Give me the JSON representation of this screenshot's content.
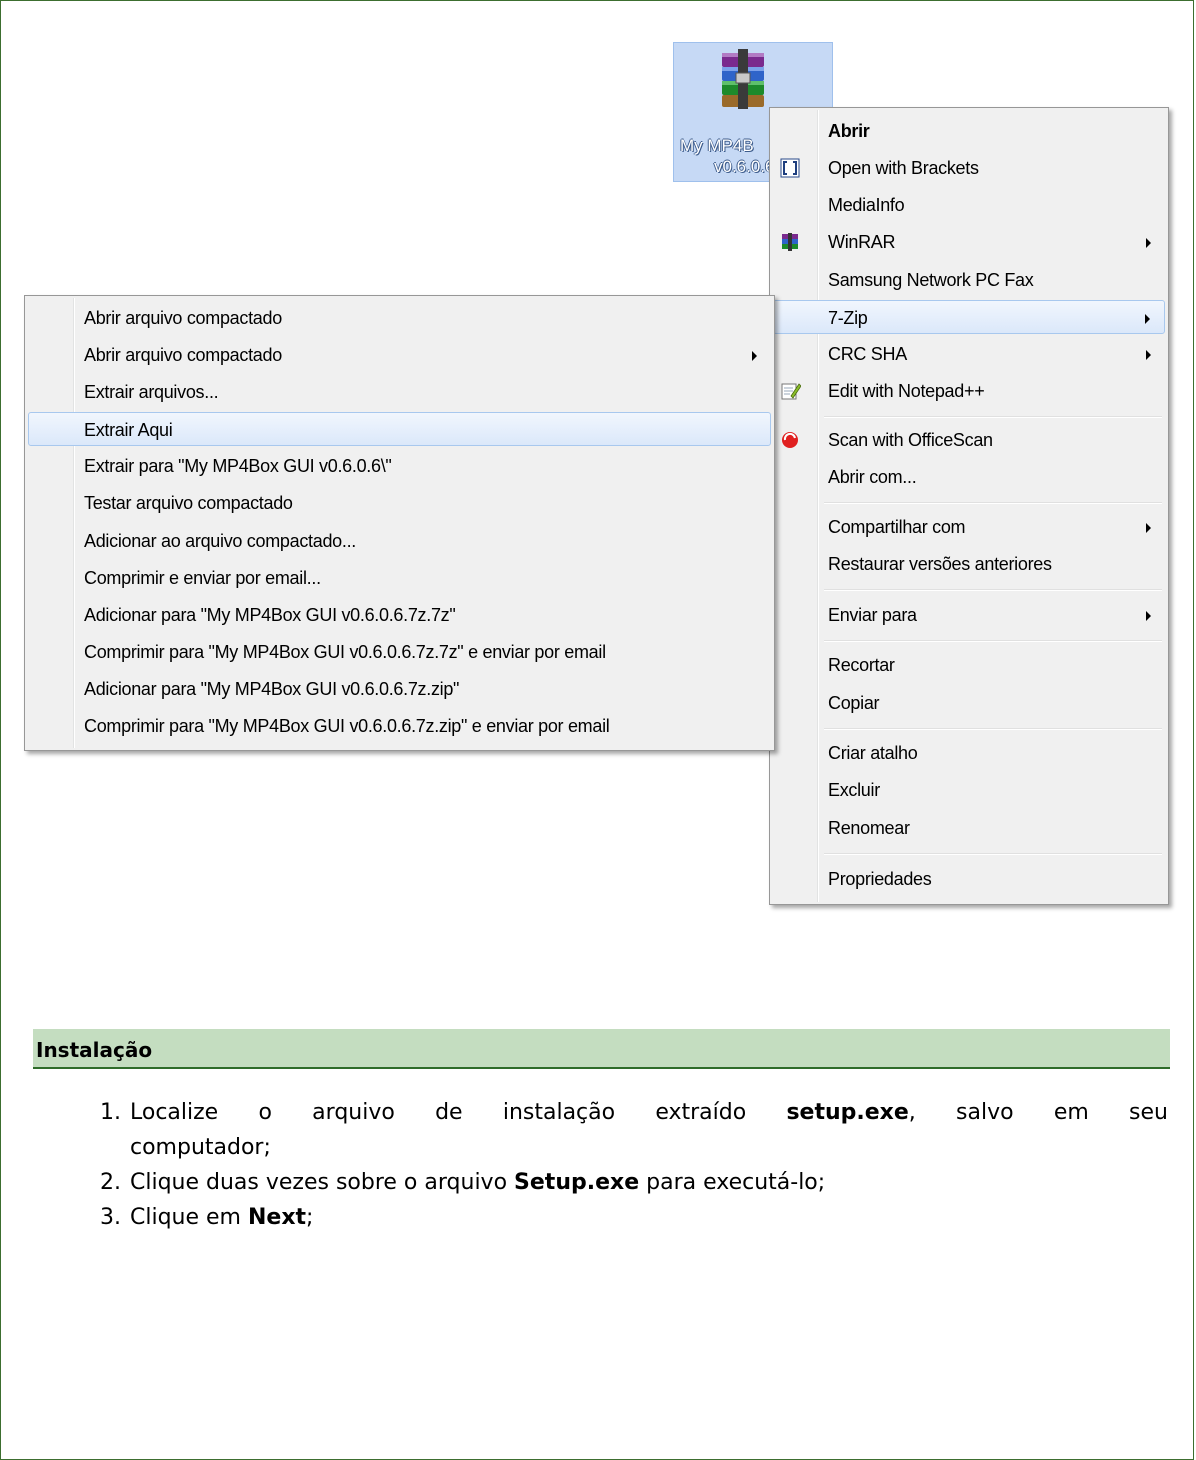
{
  "desktop_icon": {
    "label_line1": "My MP4B",
    "label_line2": "v0.6.0.6",
    "icon": "winrar-archive-icon"
  },
  "context_menu": {
    "items": [
      {
        "label": "Abrir",
        "bold": true
      },
      {
        "label": "Open with Brackets",
        "icon": "brackets-icon"
      },
      {
        "label": "MediaInfo"
      },
      {
        "label": "WinRAR",
        "icon": "winrar-icon",
        "submenu": true
      },
      {
        "label": "Samsung Network PC Fax"
      },
      {
        "label": "7-Zip",
        "submenu": true,
        "highlighted": true
      },
      {
        "label": "CRC SHA",
        "submenu": true
      },
      {
        "label": "Edit with Notepad++",
        "icon": "notepadpp-icon"
      },
      {
        "label": "Scan with OfficeScan",
        "icon": "officescan-icon"
      },
      {
        "label": "Abrir com..."
      },
      {
        "label": "Compartilhar com",
        "submenu": true
      },
      {
        "label": "Restaurar versões anteriores"
      },
      {
        "label": "Enviar para",
        "submenu": true
      },
      {
        "label": "Recortar"
      },
      {
        "label": "Copiar"
      },
      {
        "label": "Criar atalho"
      },
      {
        "label": "Excluir"
      },
      {
        "label": "Renomear"
      },
      {
        "label": "Propriedades"
      }
    ]
  },
  "zip_submenu": {
    "items": [
      {
        "label": "Abrir arquivo compactado"
      },
      {
        "label": "Abrir arquivo compactado",
        "submenu": true
      },
      {
        "label": "Extrair arquivos..."
      },
      {
        "label": "Extrair Aqui",
        "highlighted": true
      },
      {
        "label": "Extrair para \"My MP4Box GUI v0.6.0.6\\\""
      },
      {
        "label": "Testar arquivo compactado"
      },
      {
        "label": "Adicionar ao arquivo compactado..."
      },
      {
        "label": "Comprimir e enviar por email..."
      },
      {
        "label": "Adicionar para \"My MP4Box GUI v0.6.0.6.7z.7z\""
      },
      {
        "label": "Comprimir para \"My MP4Box GUI v0.6.0.6.7z.7z\" e enviar por email"
      },
      {
        "label": "Adicionar para \"My MP4Box GUI v0.6.0.6.7z.zip\""
      },
      {
        "label": "Comprimir para \"My MP4Box GUI v0.6.0.6.7z.zip\" e enviar por email"
      }
    ]
  },
  "section": {
    "title": "Instalação"
  },
  "steps": [
    {
      "num": "1.",
      "pre": "Localize o arquivo de instalação extraído ",
      "bold": "setup.exe",
      "post_line1": ", salvo em seu",
      "line2": "computador;"
    },
    {
      "num": "2.",
      "pre": "Clique duas vezes sobre o arquivo ",
      "bold": "Setup.exe",
      "post": " para executá-lo;"
    },
    {
      "num": "3.",
      "pre": "Clique em ",
      "bold": "Next",
      "post": ";"
    }
  ],
  "colors": {
    "frame_border": "#3c6e2f",
    "section_bg": "#c4ddc0",
    "section_rule": "#2f6c2a",
    "menu_bg": "#f0f0f0",
    "highlight_border": "#a8c8ee"
  }
}
